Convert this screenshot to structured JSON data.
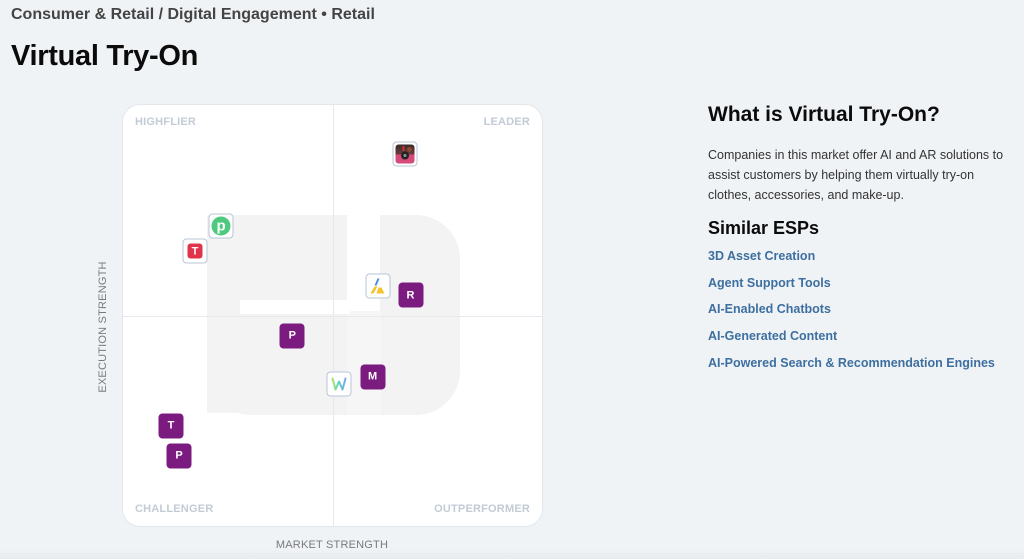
{
  "header": {
    "breadcrumb": "Consumer & Retail / Digital Engagement • Retail",
    "title": "Virtual Try-On"
  },
  "chart_data": {
    "type": "scatter",
    "title": "",
    "xlabel": "MARKET STRENGTH",
    "ylabel": "EXECUTION STRENGTH",
    "xlim": [
      0,
      100
    ],
    "ylim": [
      0,
      100
    ],
    "grid": false,
    "quadrants": {
      "top_left": "HIGHFLIER",
      "top_right": "LEADER",
      "bottom_left": "CHALLENGER",
      "bottom_right": "OUTPERFORMER"
    },
    "points": [
      {
        "label": "",
        "icon": "makeup-camera-logo-icon",
        "style": "logo",
        "x": 66.9,
        "y": 88.4,
        "color": "#d64a7a"
      },
      {
        "label": "p",
        "icon": "green-p-logo-icon",
        "style": "logo",
        "x": 23.3,
        "y": 71.3,
        "color": "#4fc97f"
      },
      {
        "label": "T",
        "icon": "red-t-logo-icon",
        "style": "logo",
        "x": 17.1,
        "y": 65.4,
        "color": "#e0344a"
      },
      {
        "label": "",
        "icon": "blue-yellow-a-logo-icon",
        "style": "logo",
        "x": 60.5,
        "y": 57.3,
        "color": "#f4c430"
      },
      {
        "label": "R",
        "icon": "",
        "style": "letter",
        "x": 68.3,
        "y": 55.0,
        "color": "#7b1b80"
      },
      {
        "label": "P",
        "icon": "",
        "style": "letter",
        "x": 40.2,
        "y": 45.5,
        "color": "#7b1b80"
      },
      {
        "label": "W",
        "icon": "gradient-w-logo-icon",
        "style": "logo",
        "x": 51.4,
        "y": 34.1,
        "color": "#5ed0c8"
      },
      {
        "label": "M",
        "icon": "",
        "style": "letter",
        "x": 59.3,
        "y": 35.8,
        "color": "#7b1b80"
      },
      {
        "label": "T",
        "icon": "",
        "style": "letter",
        "x": 11.4,
        "y": 24.2,
        "color": "#7b1b80"
      },
      {
        "label": "P",
        "icon": "",
        "style": "letter",
        "x": 13.3,
        "y": 17.1,
        "color": "#7b1b80"
      }
    ]
  },
  "sidebar": {
    "title": "What is Virtual Try-On?",
    "description": "Companies in this market offer AI and AR solutions to assist customers by helping them virtually try-on clothes, accessories, and make-up.",
    "similar_title": "Similar ESPs",
    "similar": [
      "3D Asset Creation",
      "Agent Support Tools",
      "AI-Enabled Chatbots",
      "AI-Generated Content",
      "AI-Powered Search & Recommendation Engines"
    ]
  },
  "colors": {
    "background": "#f0f3f6",
    "link": "#3d6fa0",
    "vendor_letter_bg": "#7b1b80",
    "quadrant_label": "#c3cbd6"
  }
}
